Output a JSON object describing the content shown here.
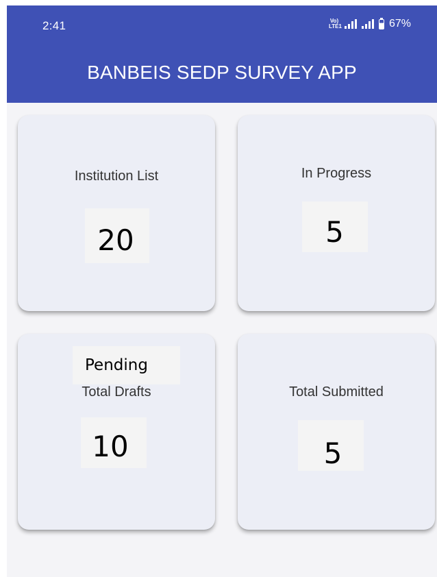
{
  "status_bar": {
    "time": "2:41",
    "network": "VoLTE",
    "battery": "67%"
  },
  "app_bar": {
    "title": "BANBEIS SEDP SURVEY APP"
  },
  "cards": [
    {
      "title": "Institution List",
      "value": "20"
    },
    {
      "title": "In Progress",
      "value": "5"
    },
    {
      "title": "Total Drafts",
      "overlay_label": "Pending",
      "value": "10"
    },
    {
      "title": "Total Submitted",
      "value": "5"
    }
  ],
  "colors": {
    "primary": "#3f51b5",
    "background": "#f4f4f7",
    "card": "#eceef6"
  }
}
